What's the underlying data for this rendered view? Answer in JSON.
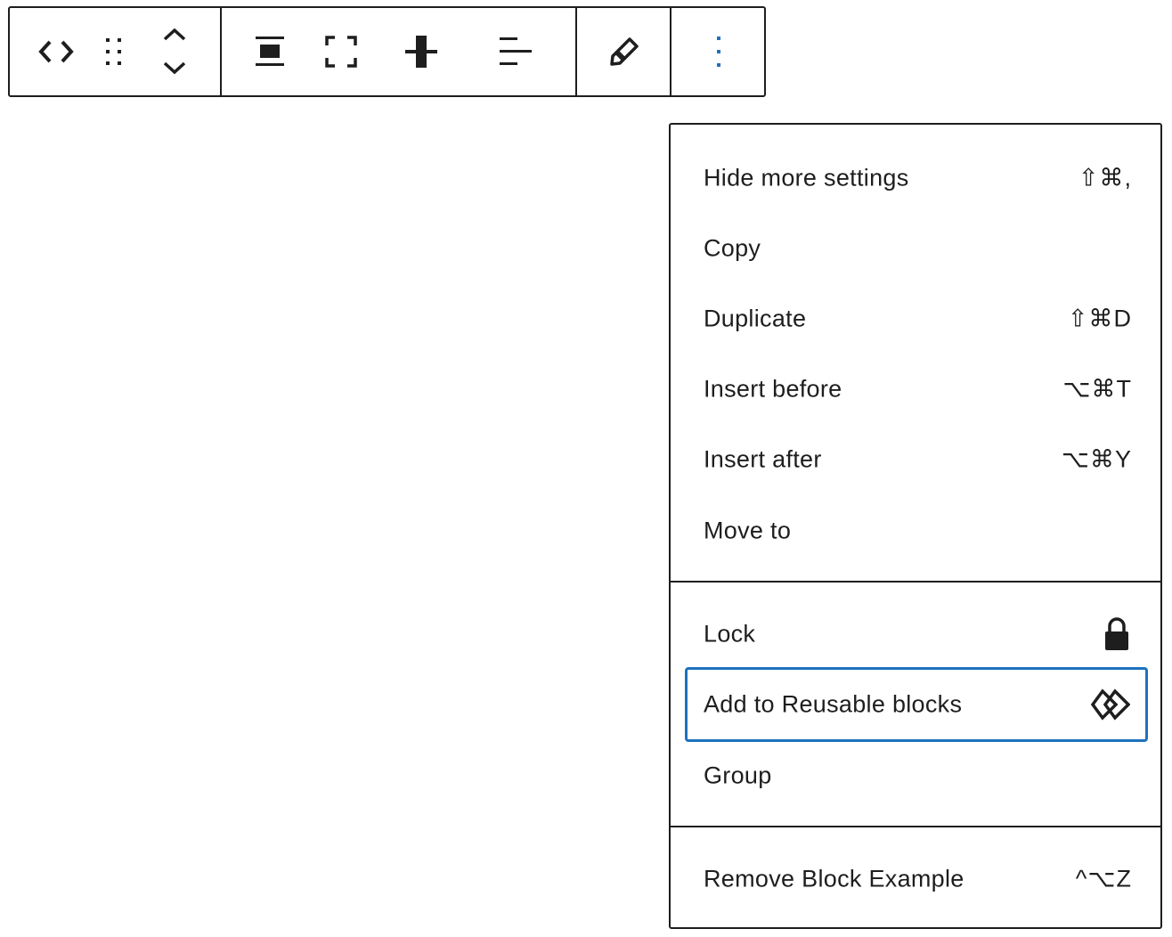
{
  "toolbar": {
    "groups": [
      {
        "buttons": [
          {
            "icon": "code-brackets-icon",
            "label": ""
          },
          {
            "icon": "drag-handle-icon",
            "label": ""
          },
          {
            "icon": "move-up-down-icon",
            "label": ""
          }
        ]
      },
      {
        "buttons": [
          {
            "icon": "align-center-icon",
            "label": ""
          },
          {
            "icon": "fullscreen-icon",
            "label": ""
          },
          {
            "icon": "vertical-align-icon",
            "label": ""
          },
          {
            "icon": "justify-left-icon",
            "label": ""
          }
        ]
      },
      {
        "buttons": [
          {
            "icon": "pencil-icon",
            "label": ""
          }
        ]
      },
      {
        "buttons": [
          {
            "icon": "more-options-icon",
            "label": ""
          }
        ]
      }
    ],
    "accent_color": "#1e72bd"
  },
  "menu": {
    "sections": [
      {
        "items": [
          {
            "label": "Hide more settings",
            "shortcut": "⇧⌘,"
          },
          {
            "label": "Copy",
            "shortcut": ""
          },
          {
            "label": "Duplicate",
            "shortcut": "⇧⌘D"
          },
          {
            "label": "Insert before",
            "shortcut": "⌥⌘T"
          },
          {
            "label": "Insert after",
            "shortcut": "⌥⌘Y"
          },
          {
            "label": "Move to",
            "shortcut": ""
          }
        ]
      },
      {
        "items": [
          {
            "label": "Lock",
            "icon": "lock-icon"
          },
          {
            "label": "Add to Reusable blocks",
            "icon": "reusable-block-icon",
            "focused": true
          },
          {
            "label": "Group",
            "icon": ""
          }
        ]
      },
      {
        "items": [
          {
            "label": "Remove Block Example",
            "shortcut": "^⌥Z"
          }
        ]
      }
    ],
    "focus_color": "#1e72bd"
  }
}
